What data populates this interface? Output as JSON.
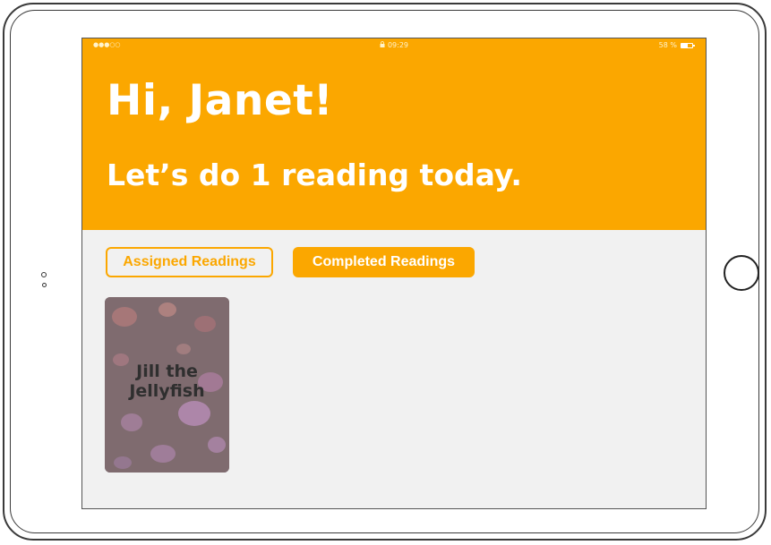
{
  "status_bar": {
    "signal": "●●●○○",
    "time": "09:29",
    "battery": "58 %",
    "battery_level": 0.58
  },
  "header": {
    "greeting": "Hi, Janet!",
    "subtitle": "Let’s do 1 reading today."
  },
  "tabs": {
    "assigned_label": "Assigned Readings",
    "completed_label": "Completed Readings"
  },
  "books": [
    {
      "title_line1": "Jill the",
      "title_line2": "Jellyfish",
      "cover_icon": "jellyfish-cover-image"
    }
  ],
  "colors": {
    "accent": "#fba700",
    "background": "#f1f1f1",
    "text_on_accent": "#ffffff"
  },
  "icons": {
    "lock": "lock-icon",
    "battery": "battery-icon",
    "home": "home-button"
  }
}
